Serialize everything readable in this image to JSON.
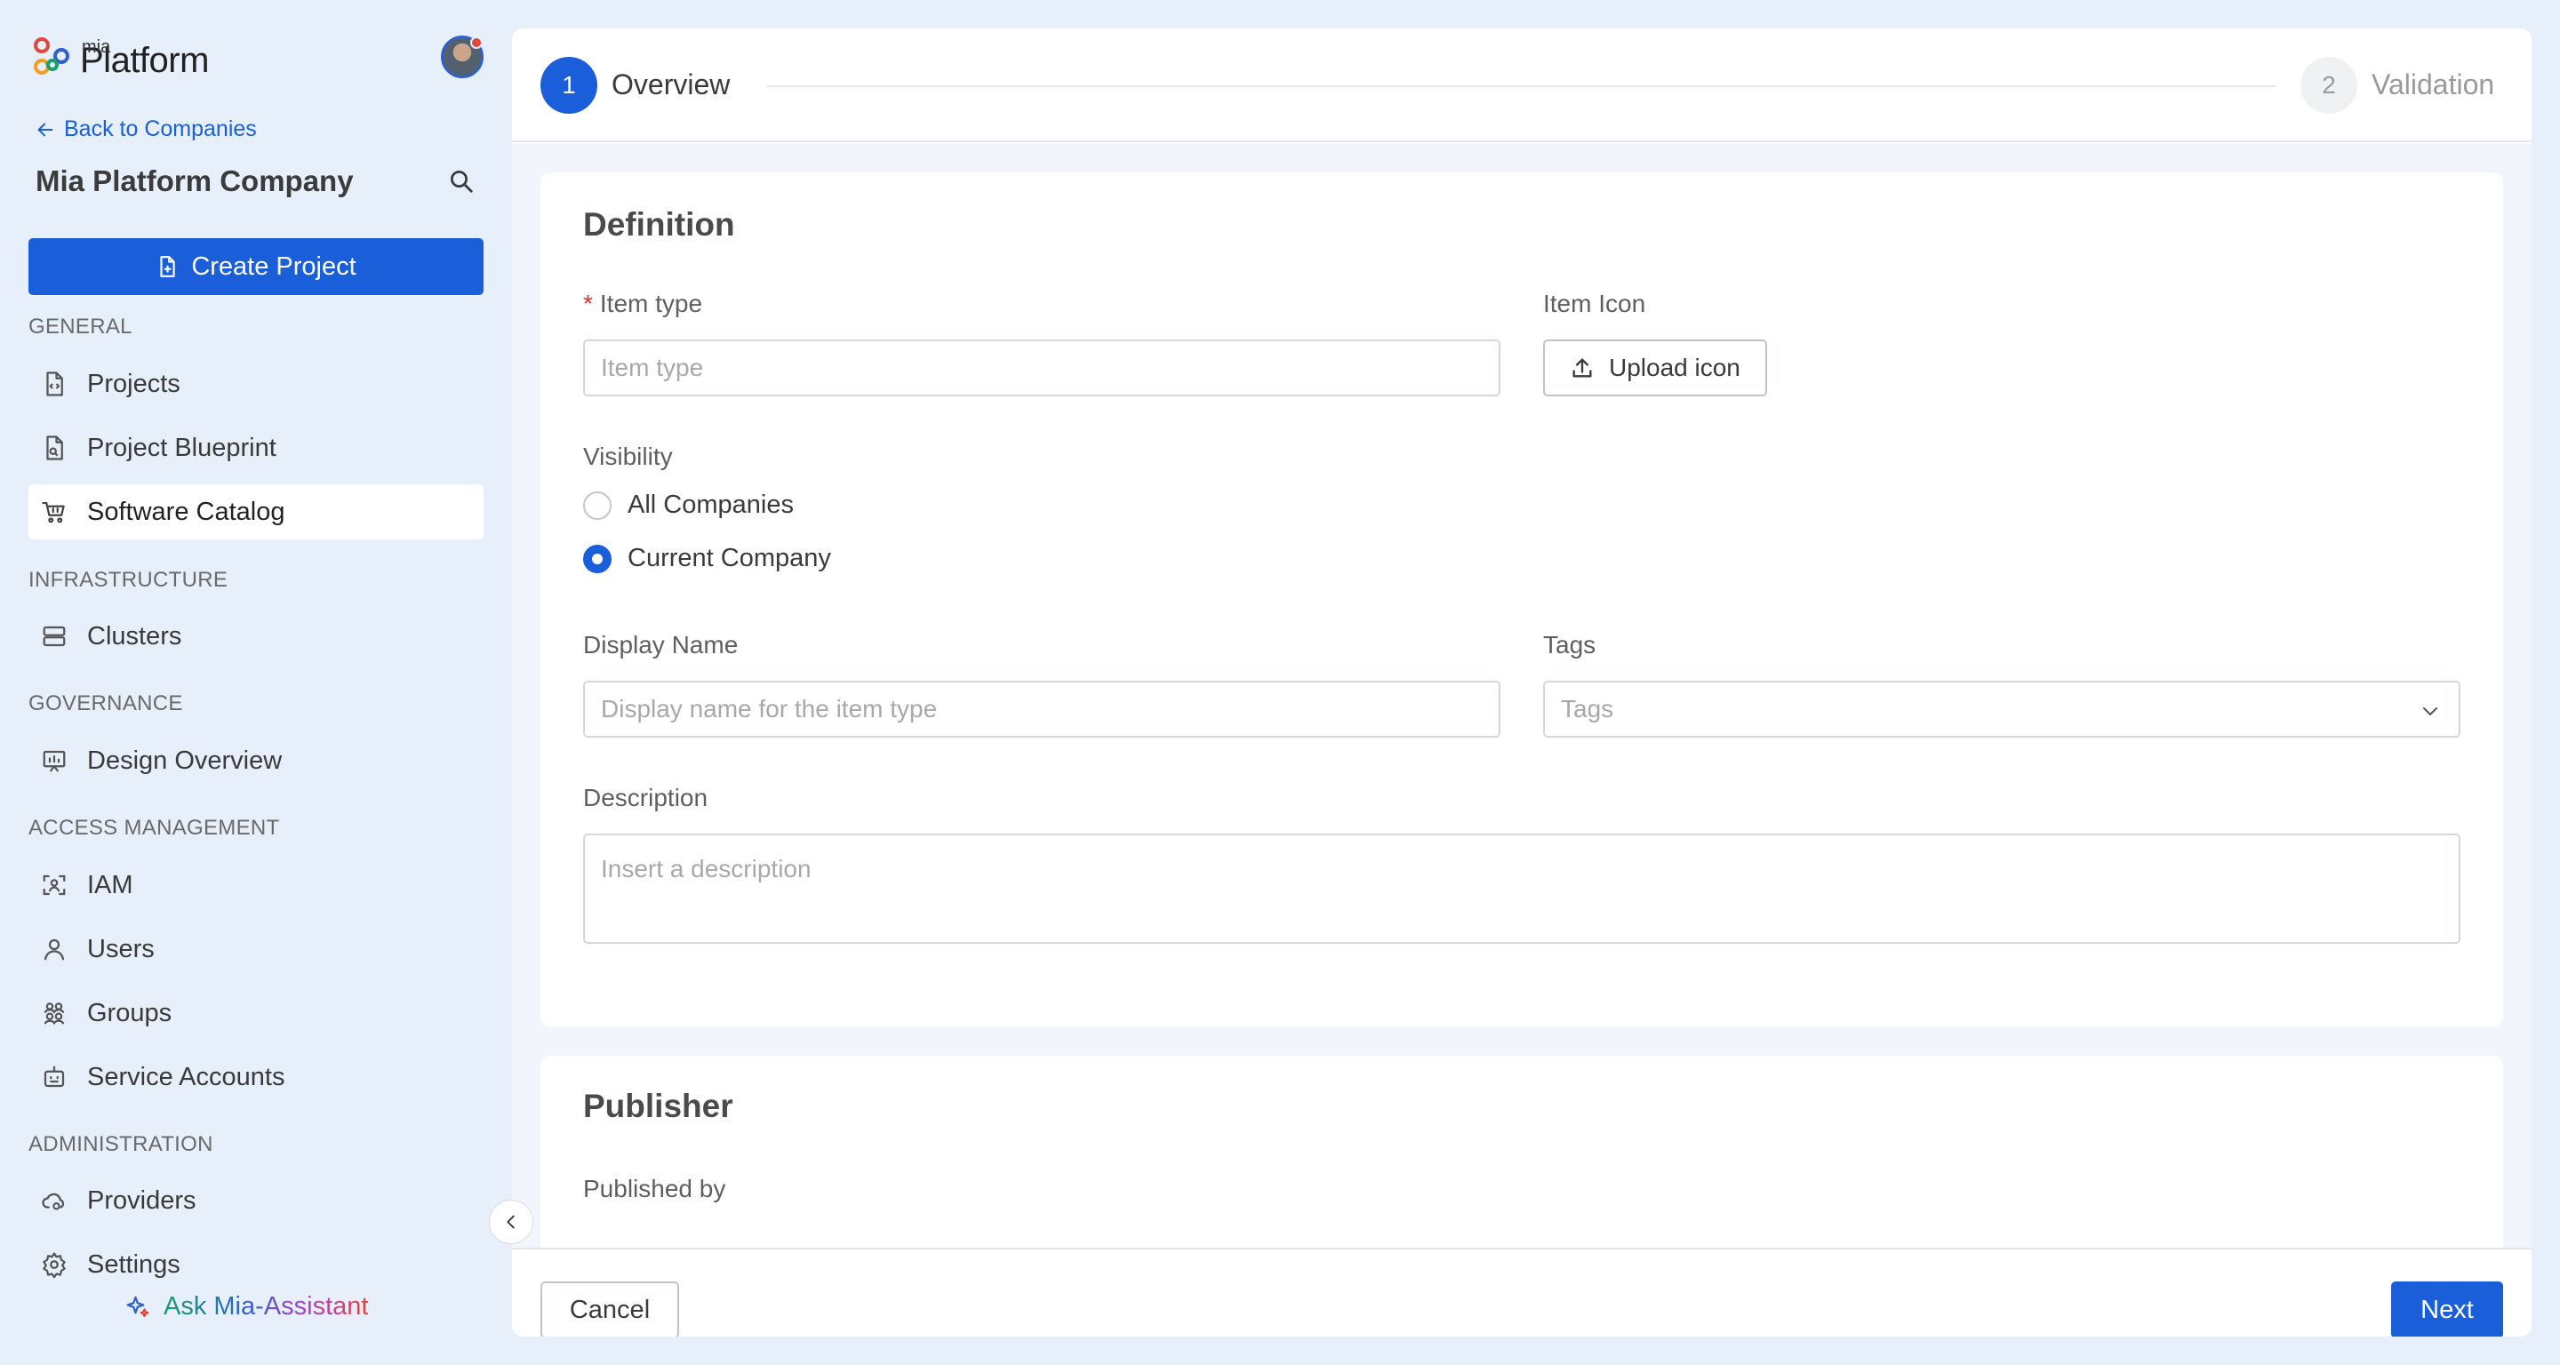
{
  "logo": {
    "small": "mia",
    "big": "Platform"
  },
  "sidebar": {
    "back_link": "Back to Companies",
    "company_name": "Mia Platform Company",
    "create_project": "Create Project",
    "sections": {
      "general": "GENERAL",
      "infrastructure": "INFRASTRUCTURE",
      "governance": "GOVERNANCE",
      "access_management": "ACCESS MANAGEMENT",
      "administration": "ADMINISTRATION"
    },
    "items": {
      "projects": "Projects",
      "project_blueprint": "Project Blueprint",
      "software_catalog": "Software Catalog",
      "clusters": "Clusters",
      "design_overview": "Design Overview",
      "iam": "IAM",
      "users": "Users",
      "groups": "Groups",
      "service_accounts": "Service Accounts",
      "providers": "Providers",
      "settings": "Settings"
    },
    "active_item": "software_catalog",
    "ask_assistant": "Ask Mia-Assistant"
  },
  "stepper": {
    "steps": [
      {
        "number": "1",
        "label": "Overview",
        "state": "active"
      },
      {
        "number": "2",
        "label": "Validation",
        "state": "inactive"
      }
    ]
  },
  "definition": {
    "title": "Definition",
    "item_type_label": "Item type",
    "item_type_placeholder": "Item type",
    "item_icon_label": "Item Icon",
    "upload_icon_label": "Upload icon",
    "visibility_label": "Visibility",
    "visibility_options": [
      {
        "label": "All Companies",
        "checked": false
      },
      {
        "label": "Current Company",
        "checked": true
      }
    ],
    "display_name_label": "Display Name",
    "display_name_placeholder": "Display name for the item type",
    "tags_label": "Tags",
    "tags_placeholder": "Tags",
    "description_label": "Description",
    "description_placeholder": "Insert a description"
  },
  "publisher": {
    "title": "Publisher",
    "published_by_label": "Published by"
  },
  "footer": {
    "cancel": "Cancel",
    "next": "Next"
  },
  "colors": {
    "primary": "#1a5fd9",
    "required": "#e0342a",
    "sidebar_bg": "#e6effa"
  }
}
